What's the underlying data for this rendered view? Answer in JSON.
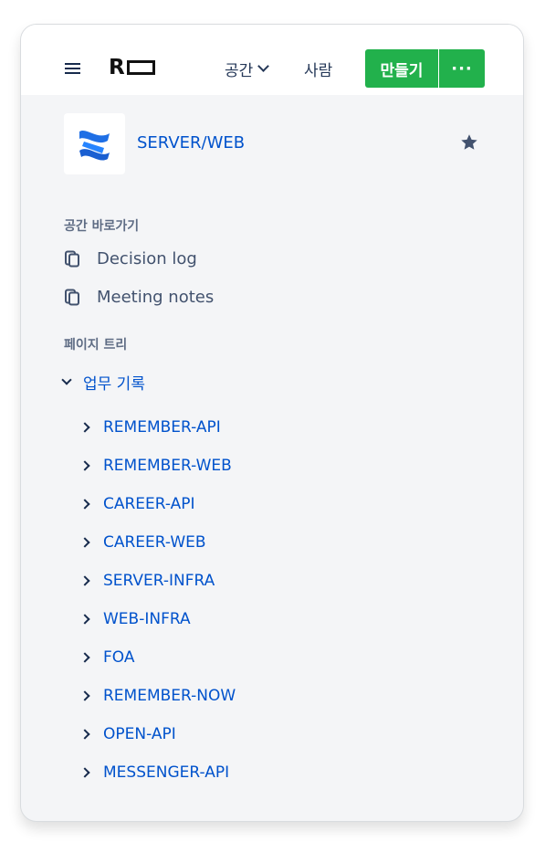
{
  "header": {
    "menu_icon": "hamburger-icon",
    "logo_text": "R",
    "nav": [
      {
        "label": "공간",
        "has_dropdown": true
      },
      {
        "label": "사람",
        "has_dropdown": false
      }
    ],
    "create_label": "만들기",
    "more_label": "···",
    "accent_color": "#22b14c"
  },
  "space": {
    "title": "SERVER/WEB",
    "logo_icon": "confluence-logo-icon",
    "star_icon": "star-icon"
  },
  "shortcuts": {
    "label": "공간 바로가기",
    "items": [
      {
        "label": "Decision log",
        "icon": "pages-icon"
      },
      {
        "label": "Meeting notes",
        "icon": "pages-icon"
      }
    ]
  },
  "tree": {
    "label": "페이지 트리",
    "root": {
      "label": "업무 기록",
      "expanded": true
    },
    "children": [
      "REMEMBER-API",
      "REMEMBER-WEB",
      "CAREER-API",
      "CAREER-WEB",
      "SERVER-INFRA",
      "WEB-INFRA",
      "FOA",
      "REMEMBER-NOW",
      "OPEN-API",
      "MESSENGER-API"
    ],
    "link_color": "#0052cc"
  }
}
